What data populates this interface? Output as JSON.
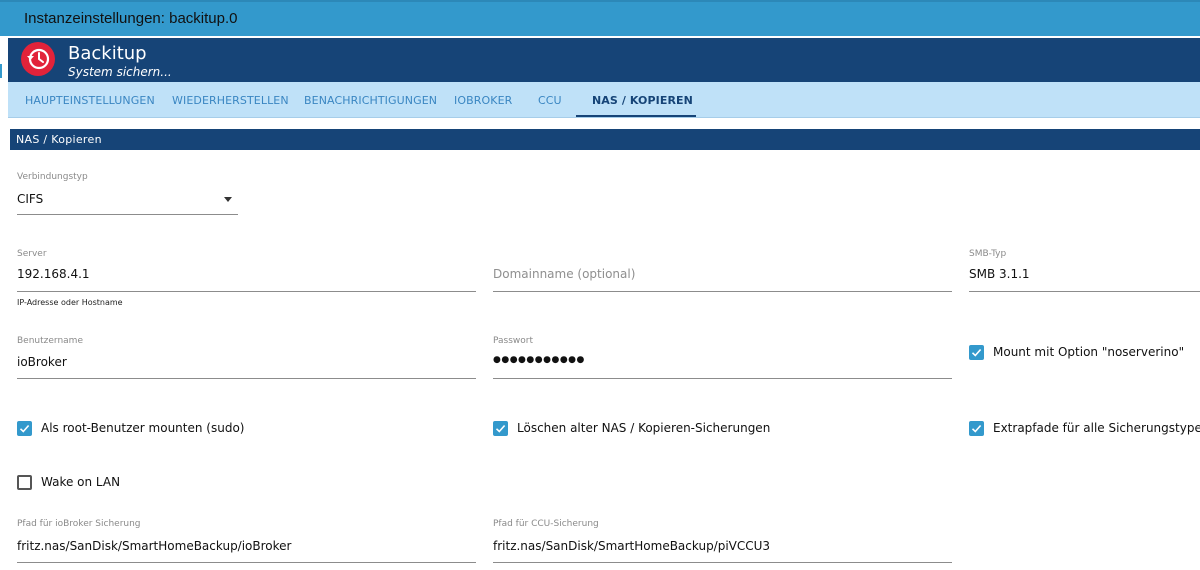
{
  "window": {
    "title": "Instanzeinstellungen: backitup.0"
  },
  "app": {
    "name": "Backitup",
    "subtitle": "System sichern...",
    "logo_icon": "history-clock-icon",
    "logo_color": "#e2233a"
  },
  "colors": {
    "titlebar": "#3399cc",
    "header": "#164477",
    "tabbar": "#bfe1f8",
    "checkbox": "#3399cc"
  },
  "tabs": [
    {
      "label": "HAUPTEINSTELLUNGEN",
      "active": false
    },
    {
      "label": "WIEDERHERSTELLEN",
      "active": false
    },
    {
      "label": "BENACHRICHTIGUNGEN",
      "active": false
    },
    {
      "label": "IOBROKER",
      "active": false
    },
    {
      "label": "CCU",
      "active": false
    },
    {
      "label": "NAS / KOPIEREN",
      "active": true
    }
  ],
  "section": {
    "title": "NAS / Kopieren"
  },
  "fields": {
    "connection_type": {
      "label": "Verbindungstyp",
      "value": "CIFS"
    },
    "server": {
      "label": "Server",
      "value": "192.168.4.1",
      "helper": "IP-Adresse oder Hostname"
    },
    "domain": {
      "placeholder": "Domainname (optional)"
    },
    "smb_type": {
      "label": "SMB-Typ",
      "value": "SMB 3.1.1"
    },
    "username": {
      "label": "Benutzername",
      "value": "ioBroker"
    },
    "password": {
      "label": "Passwort",
      "value": "●●●●●●●●●●●"
    },
    "iobroker_path": {
      "label": "Pfad für ioBroker Sicherung",
      "value": "fritz.nas/SanDisk/SmartHomeBackup/ioBroker"
    },
    "ccu_path": {
      "label": "Pfad für CCU-Sicherung",
      "value": "fritz.nas/SanDisk/SmartHomeBackup/piVCCU3"
    }
  },
  "checkboxes": {
    "noserverino": {
      "label": "Mount mit Option \"noserverino\"",
      "checked": true
    },
    "sudo": {
      "label": "Als root-Benutzer mounten (sudo)",
      "checked": true
    },
    "delete_old": {
      "label": "Löschen alter NAS / Kopieren-Sicherungen",
      "checked": true
    },
    "extra_paths": {
      "label": "Extrapfade für alle Sicherungstypen",
      "checked": true
    },
    "wake_on_lan": {
      "label": "Wake on LAN",
      "checked": false
    }
  }
}
